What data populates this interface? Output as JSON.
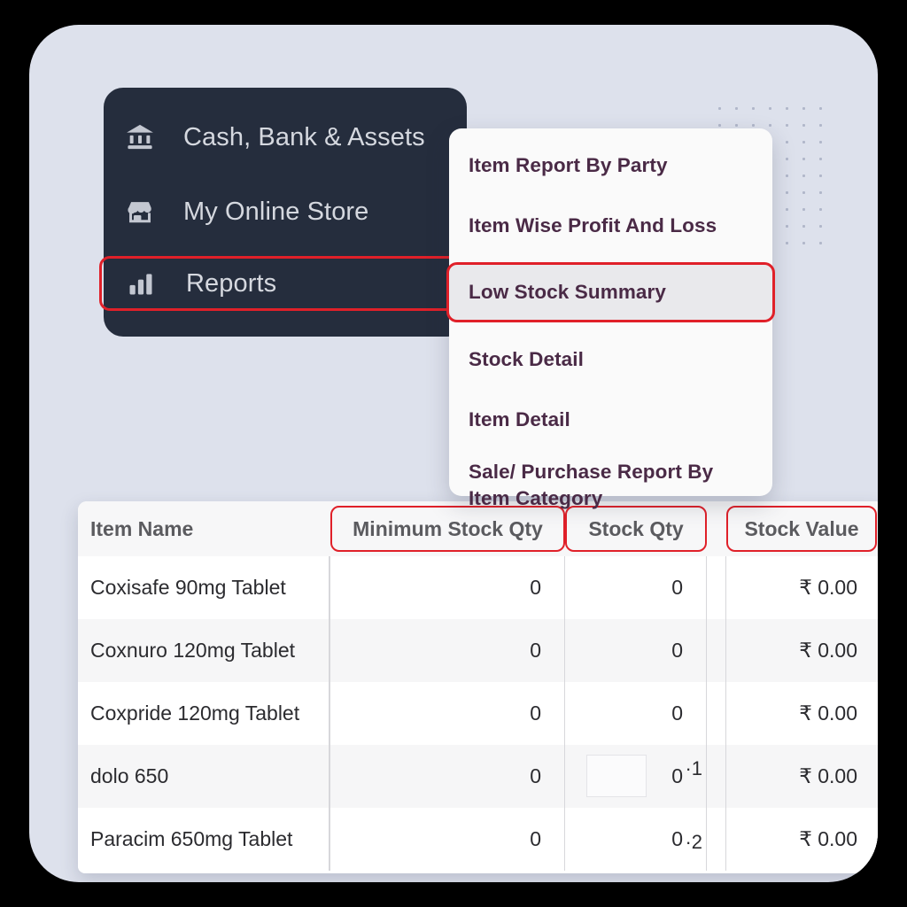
{
  "theme": {
    "page_background": "#000000",
    "panel_background": "#dde1ec",
    "sidebar_background": "#252d3d",
    "accent_highlight": "#e02029",
    "menu_text": "#4a2a46",
    "header_text": "#5b5b5f"
  },
  "sidebar": {
    "items": [
      {
        "label": "Cash, Bank & Assets",
        "icon": "bank-icon",
        "selected": false
      },
      {
        "label": "My Online Store",
        "icon": "storefront-icon",
        "selected": false
      },
      {
        "label": "Reports",
        "icon": "bar-chart-icon",
        "selected": true
      }
    ]
  },
  "dropdown": {
    "items": [
      {
        "label": "Item Report By Party",
        "selected": false
      },
      {
        "label": "Item Wise Profit And Loss",
        "selected": false
      },
      {
        "label": "Low Stock Summary",
        "selected": true
      },
      {
        "label": "Stock Detail",
        "selected": false
      },
      {
        "label": "Item Detail",
        "selected": false
      },
      {
        "label": "Sale/ Purchase Report By Item Category",
        "selected": false
      }
    ]
  },
  "table": {
    "columns": [
      {
        "label": "Item Name",
        "highlighted": false
      },
      {
        "label": "Minimum Stock Qty",
        "highlighted": true
      },
      {
        "label": "Stock Qty",
        "highlighted": true
      },
      {
        "label": "Stock Value",
        "highlighted": true
      }
    ],
    "rows": [
      {
        "item_name": "Coxisafe 90mg Tablet",
        "minimum_stock_qty": "0",
        "stock_qty": "0",
        "stock_qty_overlay": "",
        "stock_value": "₹ 0.00"
      },
      {
        "item_name": "Coxnuro 120mg Tablet",
        "minimum_stock_qty": "0",
        "stock_qty": "0",
        "stock_qty_overlay": "",
        "stock_value": "₹ 0.00"
      },
      {
        "item_name": "Coxpride 120mg Tablet",
        "minimum_stock_qty": "0",
        "stock_qty": "0",
        "stock_qty_overlay": "",
        "stock_value": "₹ 0.00"
      },
      {
        "item_name": "dolo 650",
        "minimum_stock_qty": "0",
        "stock_qty": "0",
        "stock_qty_overlay": "·1",
        "stock_value": "₹ 0.00"
      },
      {
        "item_name": "Paracim 650mg Tablet",
        "minimum_stock_qty": "0",
        "stock_qty": "0",
        "stock_qty_overlay": "·2",
        "stock_value": "₹ 0.00"
      }
    ]
  }
}
